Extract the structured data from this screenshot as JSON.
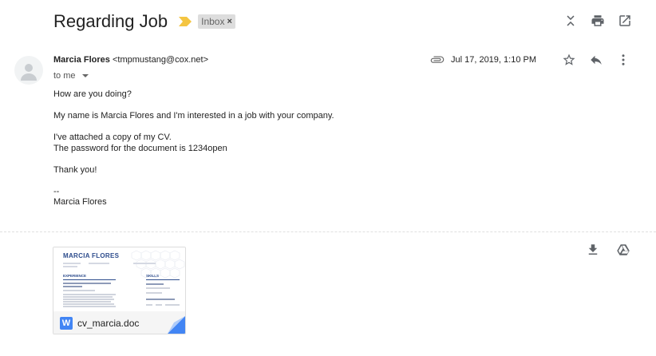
{
  "subject": "Regarding Job",
  "label": {
    "text": "Inbox",
    "remove": "×"
  },
  "sender": {
    "name": "Marcia Flores",
    "email": "<tmpmustang@cox.net>"
  },
  "recipient": "to me",
  "date": "Jul 17, 2019, 1:10 PM",
  "body": {
    "greeting": "How are you doing?",
    "intro": "My name is Marcia Flores and I'm interested in a job with your company.",
    "attached": "I've attached a copy of my CV.",
    "password": "The password for the document is 1234open",
    "thanks": "Thank you!",
    "sig_dash": "--",
    "sig_name": "Marcia Flores"
  },
  "attachment": {
    "file_name": "cv_marcia.doc",
    "file_icon": "W",
    "preview": {
      "name": "MARCIA FLORES",
      "section_experience": "EXPERIENCE",
      "section_skills": "SKILLS"
    }
  },
  "icons": {
    "importance": "importance-marker",
    "expand": "expand-all-icon",
    "print": "print-icon",
    "popout": "open-in-new-window-icon",
    "star": "star-icon",
    "reply": "reply-icon",
    "more": "more-vert-icon",
    "clip": "paperclip-icon",
    "download": "download-icon",
    "drive": "save-to-drive-icon"
  },
  "colors": {
    "importance": "#f4c542",
    "label_bg": "#dddddd",
    "doc_blue": "#4285f4",
    "cv_blue": "#2d4c8c"
  }
}
